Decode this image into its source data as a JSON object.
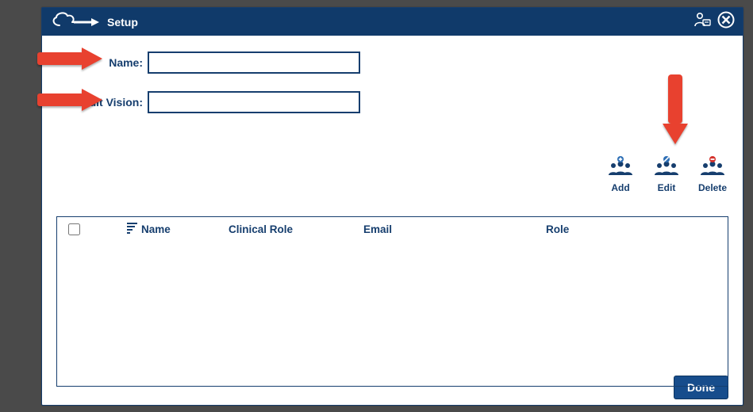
{
  "title": "Setup",
  "form": {
    "name_label": "Name:",
    "name_value": "",
    "consult_label": "Consult Vision:",
    "consult_value": ""
  },
  "actions": {
    "add": "Add",
    "edit": "Edit",
    "delete": "Delete"
  },
  "grid": {
    "columns": {
      "name": "Name",
      "clinical_role": "Clinical Role",
      "email": "Email",
      "role": "Role"
    },
    "rows": []
  },
  "footer": {
    "done": "Done"
  },
  "colors": {
    "brand": "#163e6e",
    "titlebar": "#103a6a",
    "arrow": "#e8412f",
    "delete_badge": "#d4322c",
    "add_badge": "#2e6fb5",
    "edit_badge": "#2e6fb5"
  }
}
